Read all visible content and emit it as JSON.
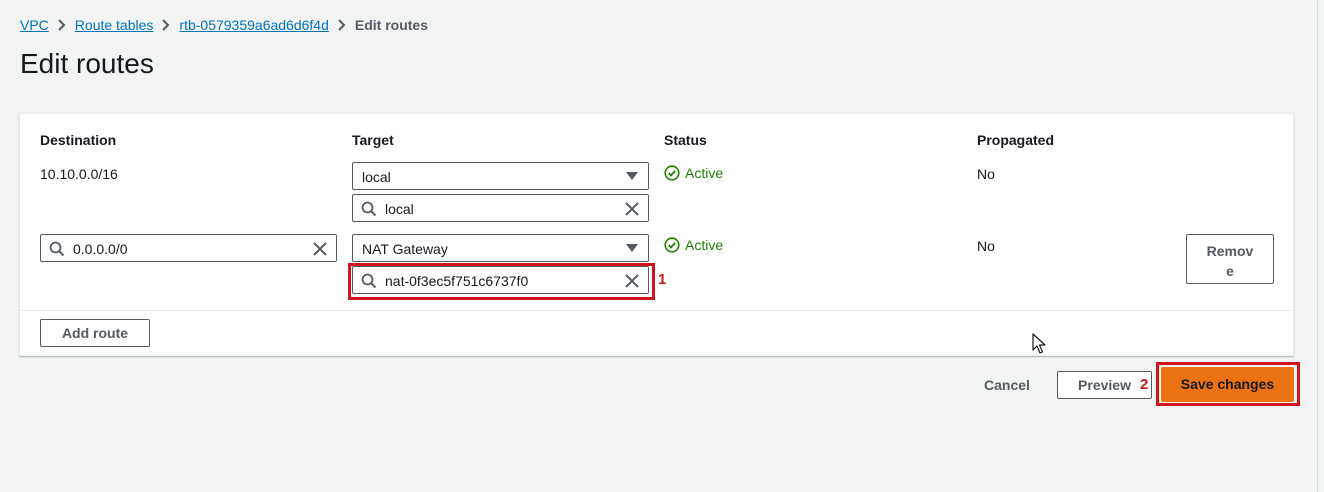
{
  "breadcrumb": {
    "vpc": "VPC",
    "route_tables": "Route tables",
    "route_table_id": "rtb-0579359a6ad6d6f4d",
    "current": "Edit routes"
  },
  "page_title": "Edit routes",
  "table": {
    "headers": {
      "destination": "Destination",
      "target": "Target",
      "status": "Status",
      "propagated": "Propagated"
    },
    "rows": [
      {
        "destination": "10.10.0.0/16",
        "target_type": "local",
        "target_value": "local",
        "status": "Active",
        "propagated": "No"
      },
      {
        "destination": "0.0.0.0/0",
        "target_type": "NAT Gateway",
        "target_value": "nat-0f3ec5f751c6737f0",
        "status": "Active",
        "propagated": "No",
        "remove_label": "Remove"
      }
    ],
    "add_route_label": "Add route"
  },
  "annotations": {
    "marker_1": "1",
    "marker_2": "2",
    "color": "#d0161c"
  },
  "actions": {
    "cancel": "Cancel",
    "preview": "Preview",
    "save": "Save changes"
  },
  "colors": {
    "link": "#0073bb",
    "status_active": "#1d8102",
    "primary_button": "#ec7211",
    "background": "#f2f3f3"
  }
}
